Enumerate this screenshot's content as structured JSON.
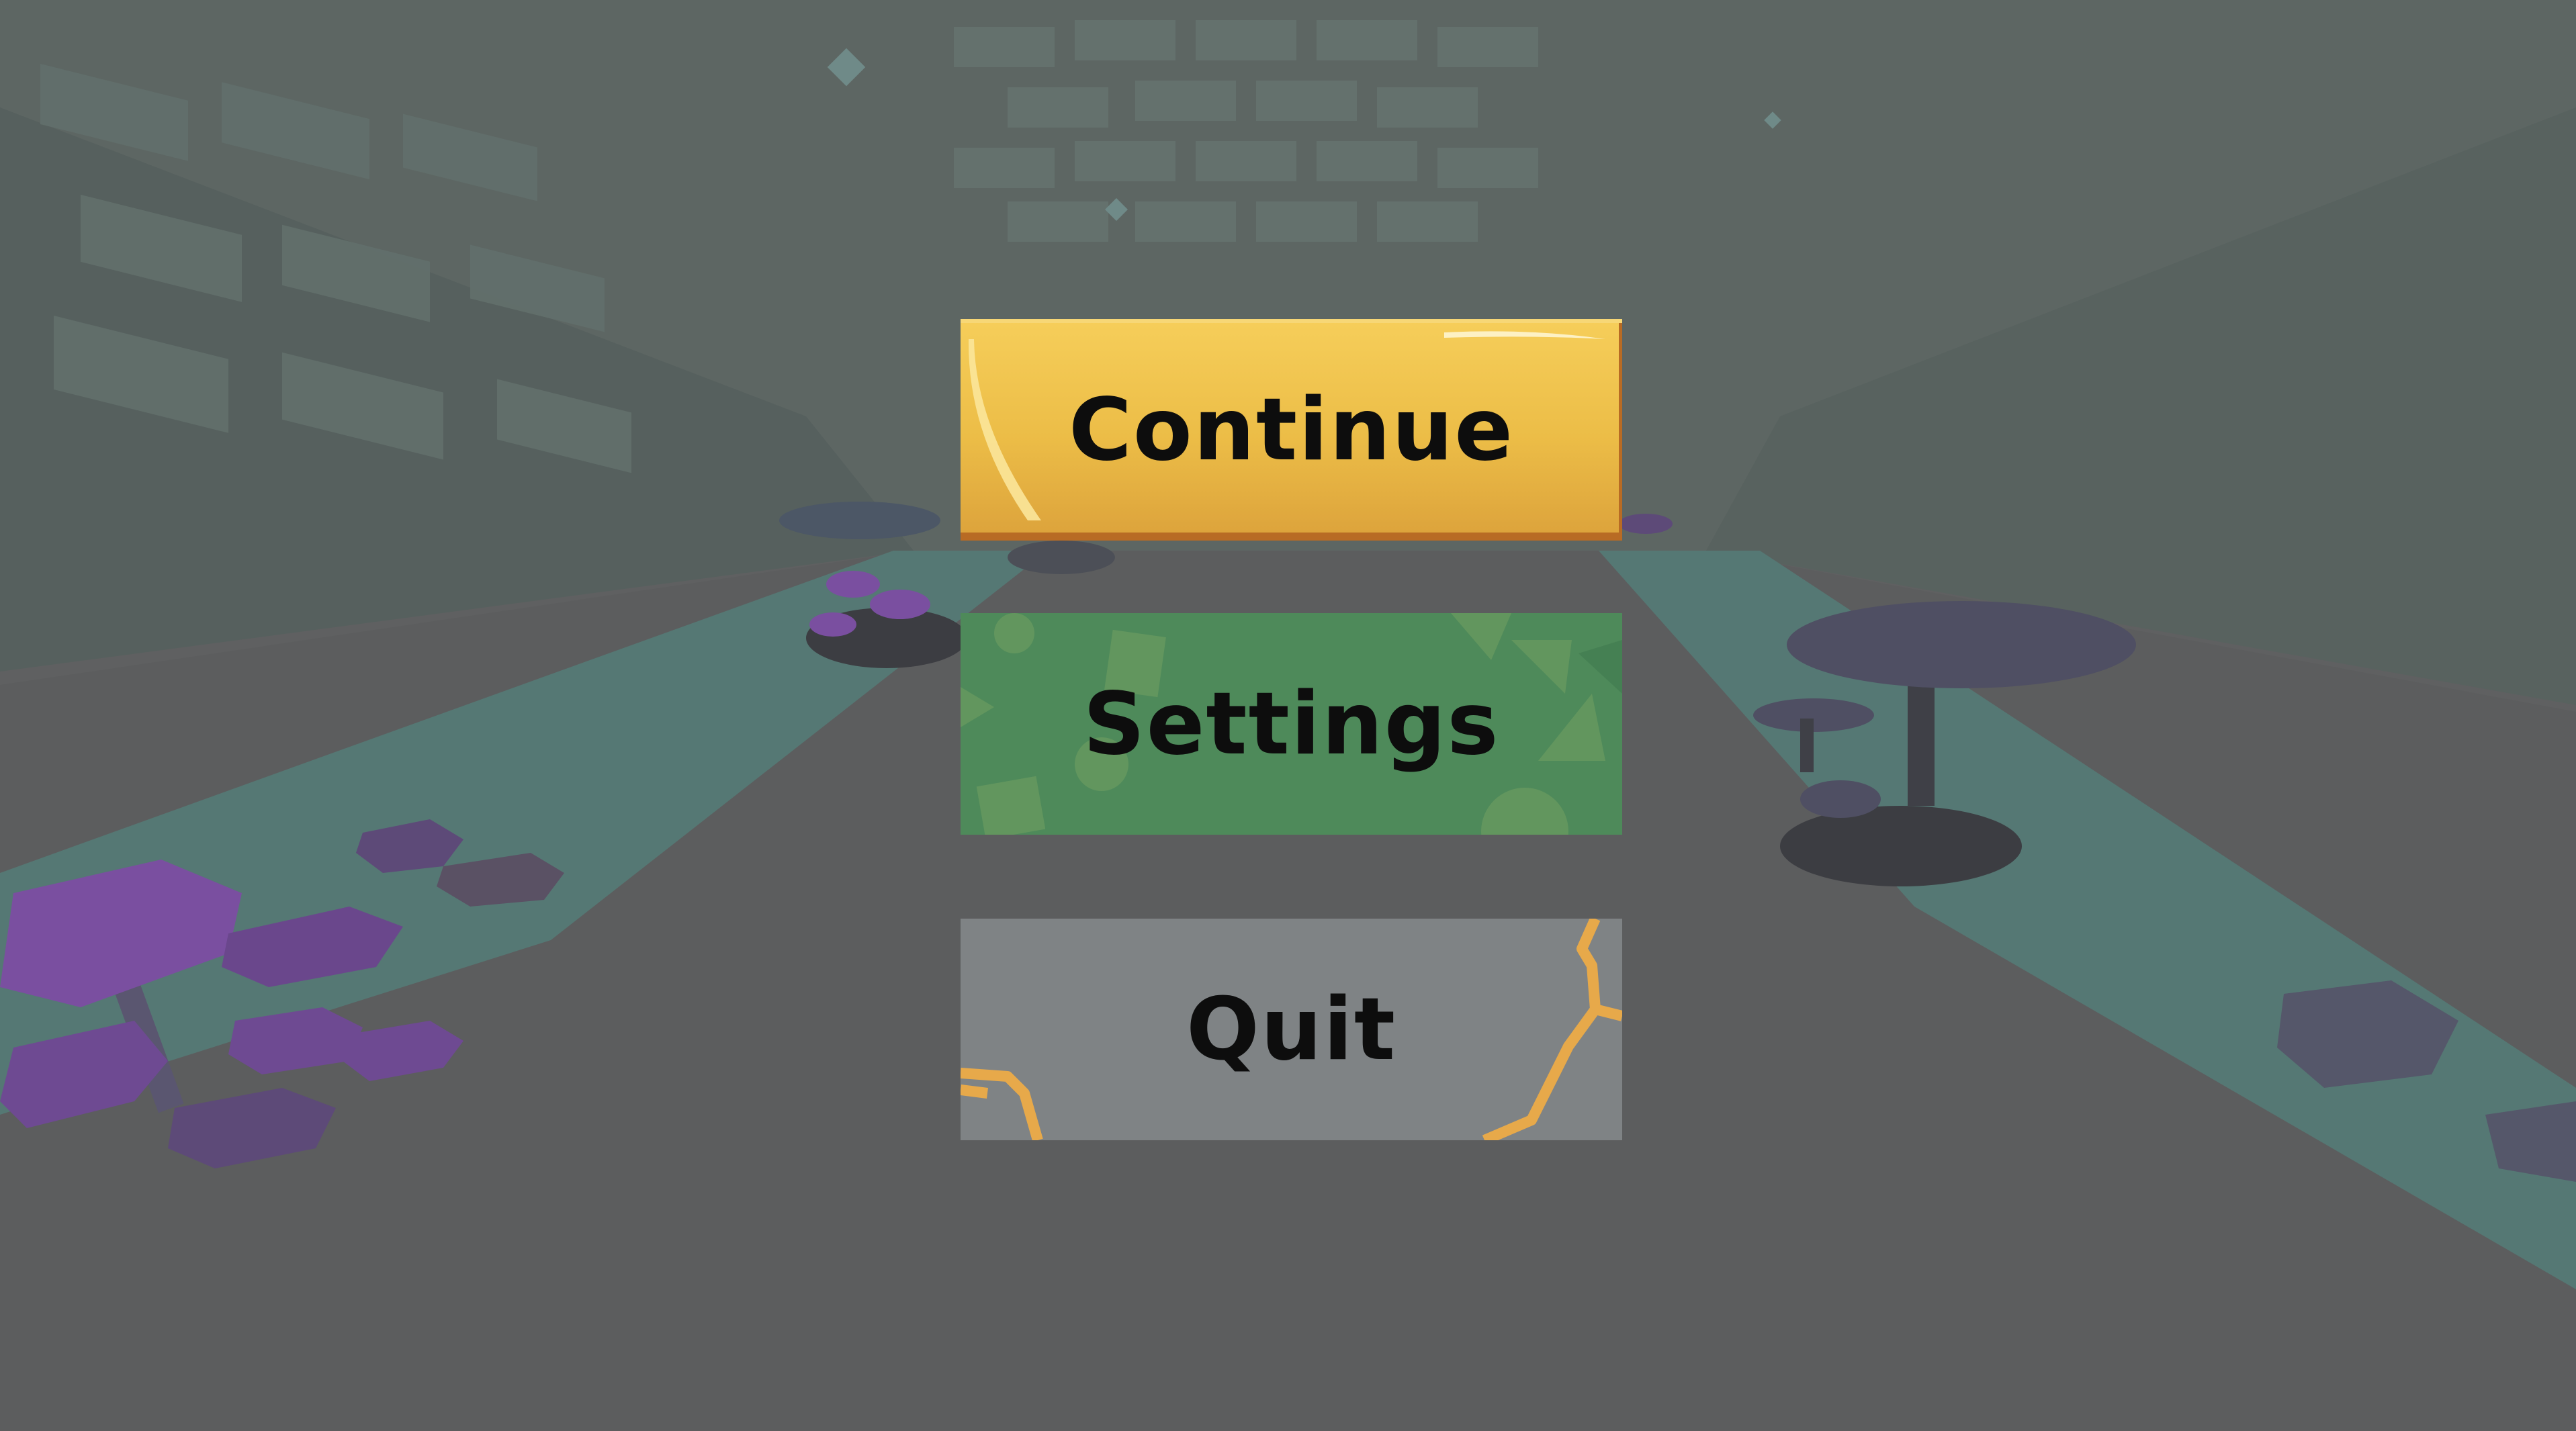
{
  "menu": {
    "continue_label": "Continue",
    "settings_label": "Settings",
    "quit_label": "Quit"
  },
  "colors": {
    "overlay": "#5f6061",
    "continue_fill": "#f0c14a",
    "continue_border": "#c2762a",
    "settings_fill": "#4e8a5a",
    "quit_fill": "#7f8385",
    "quit_cracks": "#e7a94a",
    "mushroom": "#7a4fa0"
  }
}
